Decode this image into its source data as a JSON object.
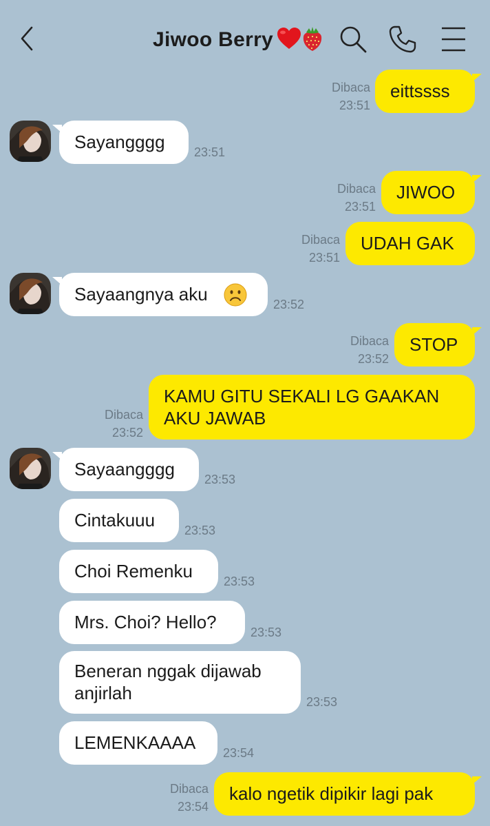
{
  "header": {
    "title": "Jiwoo Berry",
    "heart_emoji": "❤️",
    "berry_emoji": "🍓"
  },
  "colors": {
    "background": "#abc1d1",
    "my_bubble": "#fde900",
    "their_bubble": "#ffffff",
    "meta_text": "#6b7a86"
  },
  "messages": [
    {
      "from": "me",
      "text": "eittssss",
      "read": "Dibaca",
      "time": "23:51"
    },
    {
      "from": "them",
      "text": "Sayangggg",
      "time": "23:51"
    },
    {
      "from": "me",
      "text": "JIWOO",
      "read": "Dibaca",
      "time": "23:51"
    },
    {
      "from": "me",
      "text": "UDAH GAK",
      "read": "Dibaca",
      "time": "23:51"
    },
    {
      "from": "them",
      "text": "Sayaangnya aku",
      "emoji": "🙁",
      "time": "23:52"
    },
    {
      "from": "me",
      "text": "STOP",
      "read": "Dibaca",
      "time": "23:52"
    },
    {
      "from": "me",
      "line1": "KAMU GITU SEKALI LG GAAKAN",
      "line2": "AKU JAWAB",
      "read": "Dibaca",
      "time": "23:52"
    },
    {
      "from": "them",
      "text": "Sayaangggg",
      "time": "23:53"
    },
    {
      "from": "them",
      "text": "Cintakuuu",
      "time": "23:53"
    },
    {
      "from": "them",
      "text": "Choi Remenku",
      "time": "23:53"
    },
    {
      "from": "them",
      "text": "Mrs. Choi? Hello?",
      "time": "23:53"
    },
    {
      "from": "them",
      "line1": "Beneran nggak dijawab",
      "line2": "anjirlah",
      "time": "23:53"
    },
    {
      "from": "them",
      "text": "LEMENKAAAA",
      "time": "23:54"
    },
    {
      "from": "me",
      "text": "kalo ngetik dipikir lagi pak",
      "read": "Dibaca",
      "time": "23:54"
    }
  ]
}
